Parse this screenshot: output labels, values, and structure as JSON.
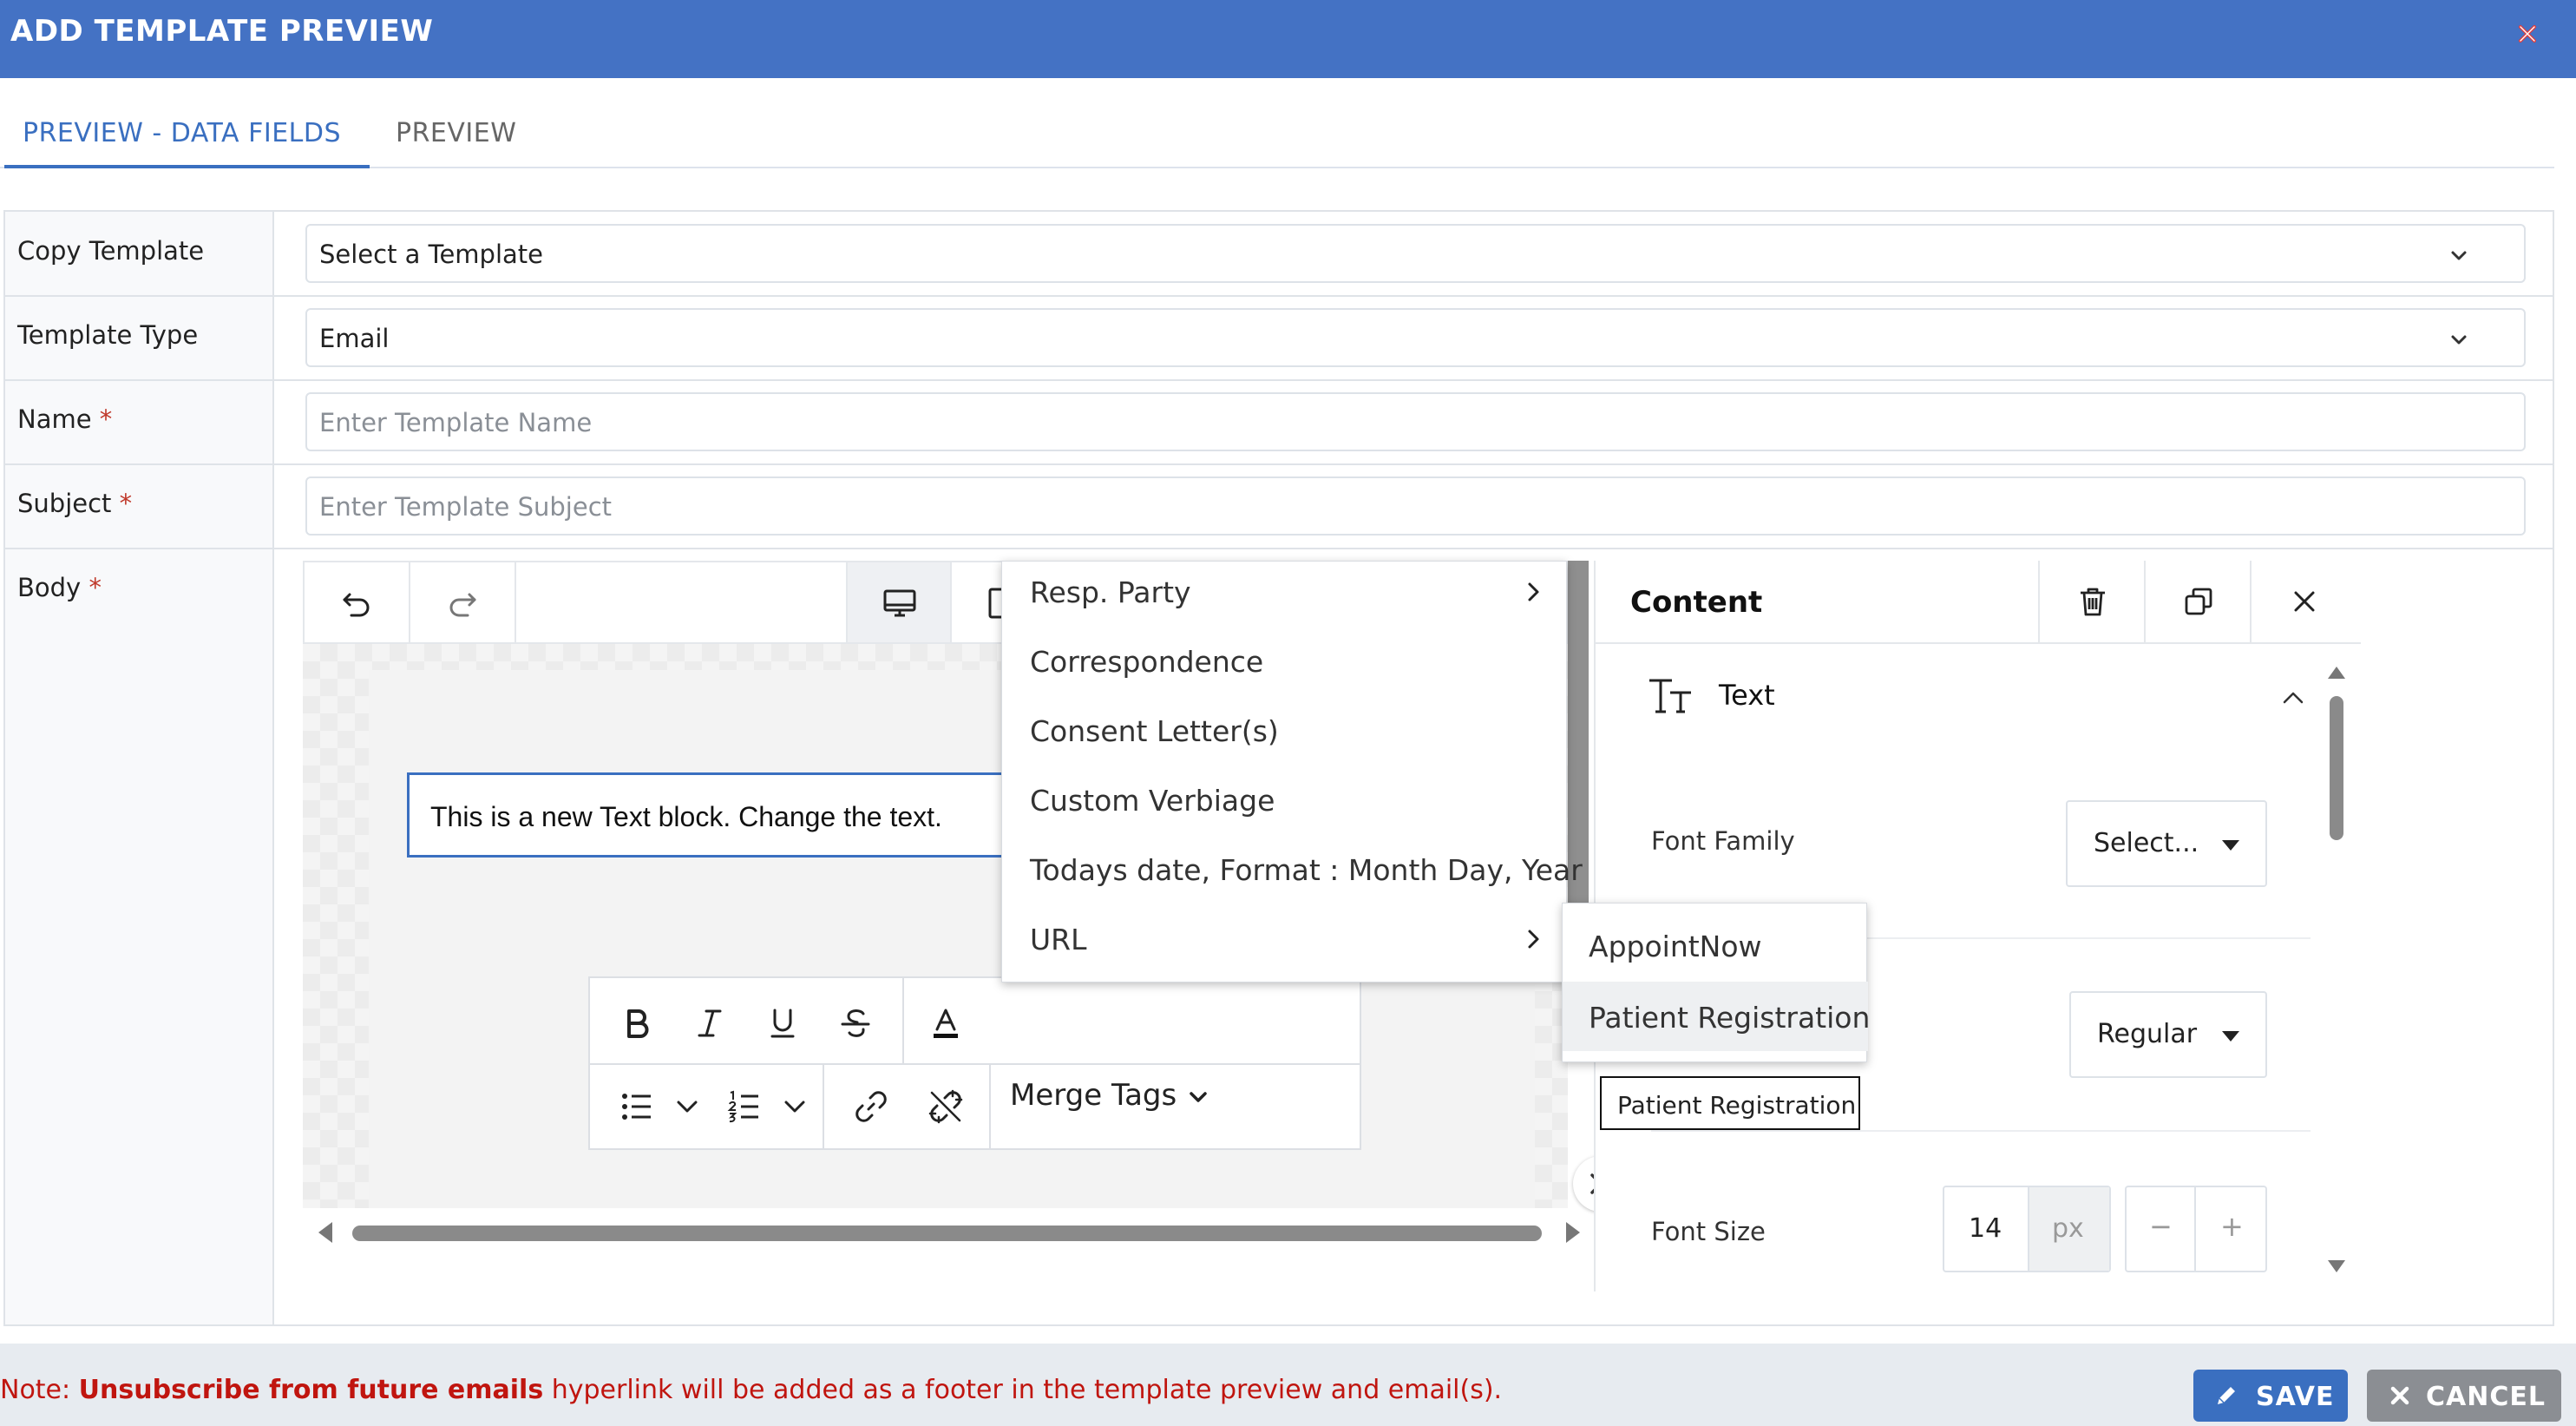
{
  "header": {
    "title": "ADD TEMPLATE PREVIEW"
  },
  "tabs": [
    {
      "label": "PREVIEW - DATA FIELDS",
      "active": true
    },
    {
      "label": "PREVIEW",
      "active": false
    }
  ],
  "form": {
    "copy_template": {
      "label": "Copy Template",
      "value": "Select a Template"
    },
    "template_type": {
      "label": "Template Type",
      "value": "Email"
    },
    "name": {
      "label": "Name",
      "required_mark": "*",
      "placeholder": "Enter Template Name"
    },
    "subject": {
      "label": "Subject",
      "required_mark": "*",
      "placeholder": "Enter Template Subject"
    },
    "body": {
      "label": "Body",
      "required_mark": "*"
    }
  },
  "editor": {
    "text_block": "This is a new Text block. Change the text.",
    "merge_tags_label": "Merge Tags",
    "merge_menu": [
      {
        "label": "Resp. Party",
        "has_submenu": true
      },
      {
        "label": "Correspondence",
        "has_submenu": false
      },
      {
        "label": "Consent Letter(s)",
        "has_submenu": false
      },
      {
        "label": "Custom Verbiage",
        "has_submenu": false
      },
      {
        "label": "Todays date, Format : Month Day, Year",
        "has_submenu": false
      },
      {
        "label": "URL",
        "has_submenu": true
      }
    ],
    "url_submenu": [
      {
        "label": "AppointNow",
        "hovered": false
      },
      {
        "label": "Patient Registration",
        "hovered": true
      }
    ],
    "tooltip": "Patient Registration"
  },
  "content_panel": {
    "title": "Content",
    "section_title": "Text",
    "font_family": {
      "label": "Font Family",
      "value": "Select..."
    },
    "font_weight": {
      "value": "Regular"
    },
    "font_size": {
      "label": "Font Size",
      "value": "14",
      "unit": "px",
      "minus": "−",
      "plus": "+"
    }
  },
  "footer": {
    "note_prefix": "Note: ",
    "note_bold": "Unsubscribe from future emails",
    "note_suffix": " hyperlink will be added as a footer in the template preview and email(s).",
    "save_label": "SAVE",
    "cancel_label": "CANCEL"
  },
  "colors": {
    "header_bg": "#4472c4",
    "accent": "#3a6fc0",
    "note_text": "#c0150f",
    "cancel_bg": "#8b8e93"
  },
  "icons": [
    "close-icon",
    "chevron-down-icon",
    "undo-icon",
    "redo-icon",
    "desktop-icon",
    "bold-icon",
    "italic-icon",
    "underline-icon",
    "strikethrough-icon",
    "font-color-icon",
    "bullet-list-icon",
    "numbered-list-icon",
    "link-icon",
    "unlink-icon",
    "chevron-right-icon",
    "trash-icon",
    "duplicate-icon",
    "text-type-icon",
    "chevron-up-icon",
    "double-chevron-right-icon",
    "pencil-icon"
  ]
}
